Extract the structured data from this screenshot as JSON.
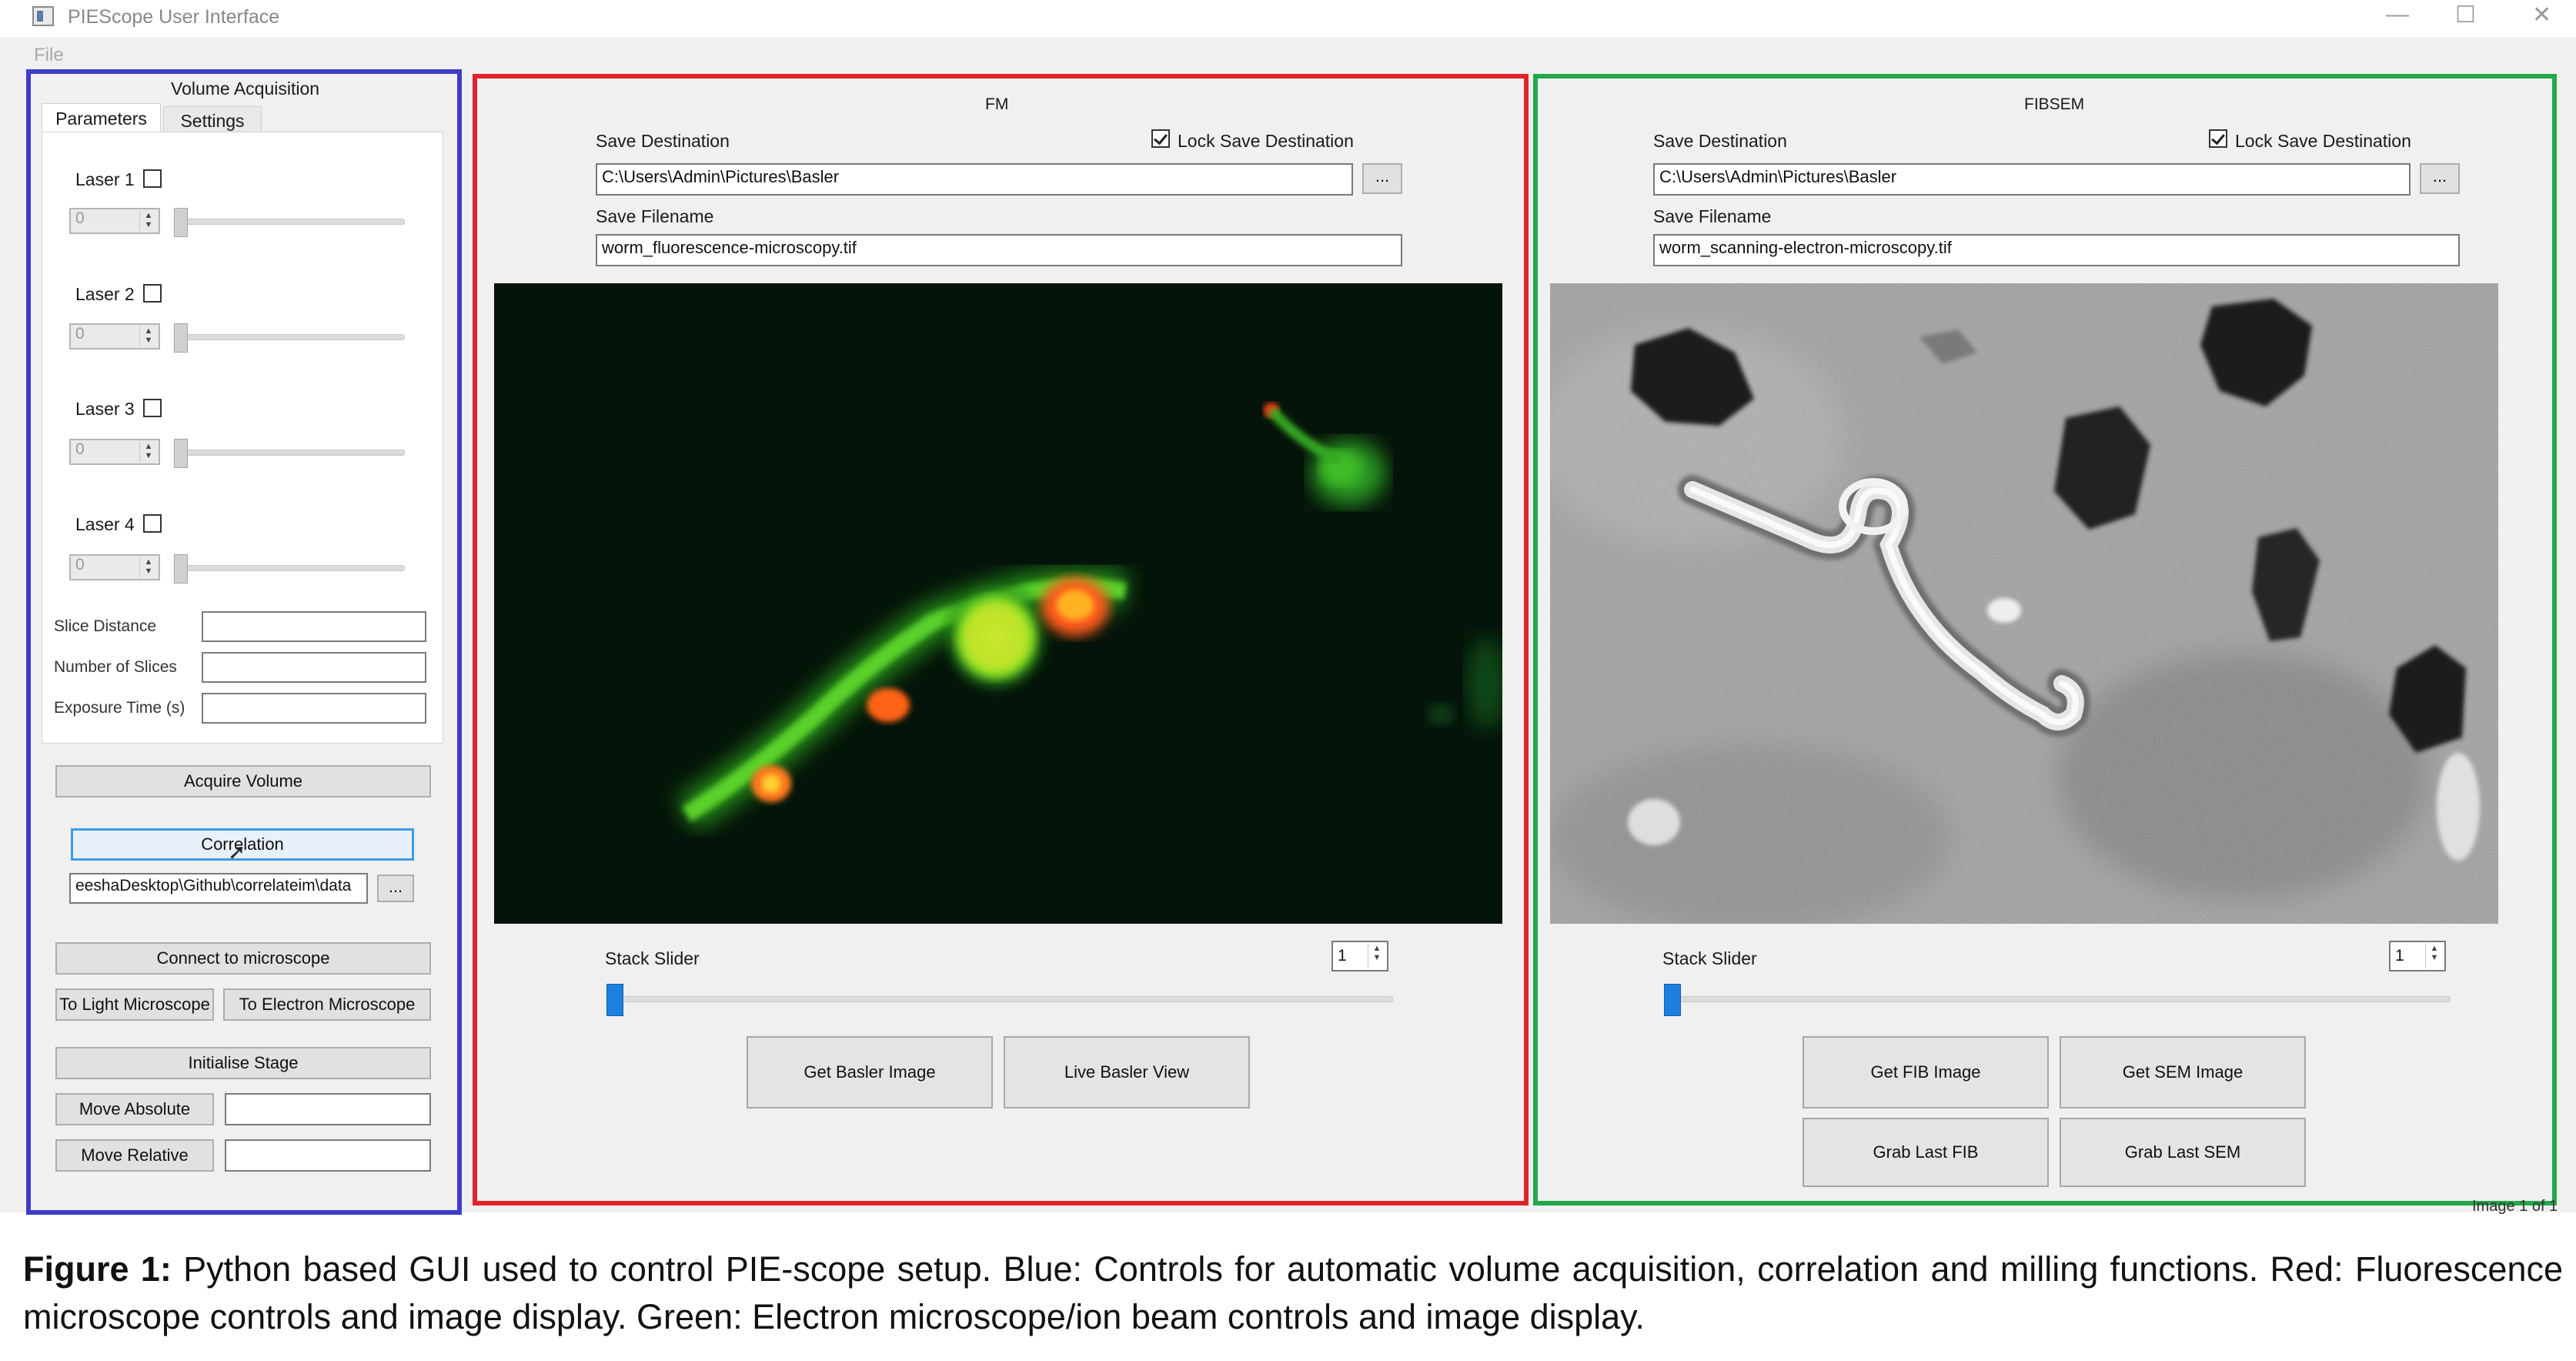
{
  "window": {
    "title": "PIEScope User Interface",
    "menu_file": "File",
    "controls": {
      "minimize": "—",
      "maximize": "☐",
      "close": "✕"
    }
  },
  "left_panel": {
    "header": "Volume Acquisition",
    "tabs": [
      "Parameters",
      "Settings"
    ],
    "lasers": [
      {
        "label": "Laser 1",
        "value": "0"
      },
      {
        "label": "Laser 2",
        "value": "0"
      },
      {
        "label": "Laser 3",
        "value": "0"
      },
      {
        "label": "Laser 4",
        "value": "0"
      }
    ],
    "slice_distance_label": "Slice Distance",
    "number_of_slices_label": "Number of Slices",
    "exposure_time_label": "Exposure Time (s)",
    "acquire_volume": "Acquire Volume",
    "correlation": "Correlation",
    "correlation_path": "eeshaDesktop\\Github\\correlateim\\data",
    "browse": "...",
    "connect": "Connect to microscope",
    "to_light": "To Light Microscope",
    "to_electron": "To Electron Microscope",
    "initialise_stage": "Initialise Stage",
    "move_absolute": "Move Absolute",
    "move_relative": "Move Relative"
  },
  "fm_panel": {
    "header": "FM",
    "save_destination_label": "Save Destination",
    "lock_label": "Lock Save Destination",
    "save_destination": "C:\\Users\\Admin\\Pictures\\Basler",
    "browse": "...",
    "save_filename_label": "Save Filename",
    "save_filename": "worm_fluorescence-microscopy.tif",
    "stack_slider_label": "Stack Slider",
    "stack_value": "1",
    "get_image": "Get Basler Image",
    "live_view": "Live Basler View"
  },
  "fib_panel": {
    "header": "FIBSEM",
    "save_destination_label": "Save Destination",
    "lock_label": "Lock Save Destination",
    "save_destination": "C:\\Users\\Admin\\Pictures\\Basler",
    "browse": "...",
    "save_filename_label": "Save Filename",
    "save_filename": "worm_scanning-electron-microscopy.tif",
    "stack_slider_label": "Stack Slider",
    "stack_value": "1",
    "get_fib": "Get FIB Image",
    "get_sem": "Get SEM Image",
    "grab_fib": "Grab Last FIB",
    "grab_sem": "Grab Last SEM"
  },
  "status_text": "Image 1 of 1",
  "caption": {
    "label": "Figure 1:",
    "text": "Python based GUI used to control PIE-scope setup. Blue:  Controls for automatic volume acquisition, correlation and milling functions. Red:  Fluorescence microscope controls and image display.  Green:  Electron microscope/ion beam controls and image display."
  },
  "colors": {
    "blue_frame": "#3d3dc8",
    "red_frame": "#e0252a",
    "green_frame": "#25a84a",
    "slider_handle": "#1d7fe0"
  }
}
